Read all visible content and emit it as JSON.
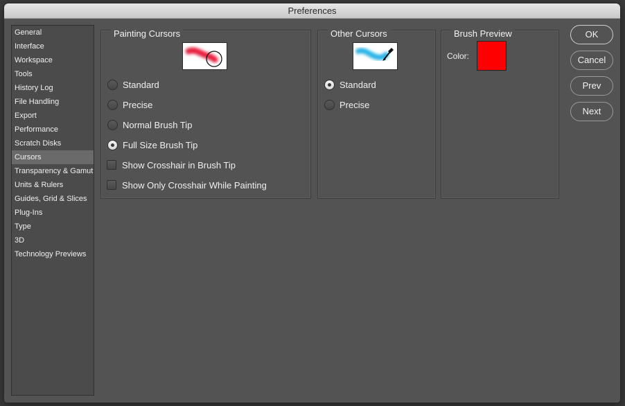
{
  "window": {
    "title": "Preferences"
  },
  "sidebar": {
    "items": [
      {
        "label": "General"
      },
      {
        "label": "Interface"
      },
      {
        "label": "Workspace"
      },
      {
        "label": "Tools"
      },
      {
        "label": "History Log"
      },
      {
        "label": "File Handling"
      },
      {
        "label": "Export"
      },
      {
        "label": "Performance"
      },
      {
        "label": "Scratch Disks"
      },
      {
        "label": "Cursors",
        "selected": true
      },
      {
        "label": "Transparency & Gamut"
      },
      {
        "label": "Units & Rulers"
      },
      {
        "label": "Guides, Grid & Slices"
      },
      {
        "label": "Plug-Ins"
      },
      {
        "label": "Type"
      },
      {
        "label": "3D"
      },
      {
        "label": "Technology Previews"
      }
    ]
  },
  "painting_cursors": {
    "title": "Painting Cursors",
    "options": [
      {
        "label": "Standard",
        "checked": false
      },
      {
        "label": "Precise",
        "checked": false
      },
      {
        "label": "Normal Brush Tip",
        "checked": false
      },
      {
        "label": "Full Size Brush Tip",
        "checked": true
      }
    ],
    "checkboxes": [
      {
        "label": "Show Crosshair in Brush Tip",
        "checked": false
      },
      {
        "label": "Show Only Crosshair While Painting",
        "checked": false
      }
    ]
  },
  "other_cursors": {
    "title": "Other Cursors",
    "options": [
      {
        "label": "Standard",
        "checked": true
      },
      {
        "label": "Precise",
        "checked": false
      }
    ]
  },
  "brush_preview": {
    "title": "Brush Preview",
    "color_label": "Color:",
    "color": "#ff0000"
  },
  "buttons": {
    "ok": "OK",
    "cancel": "Cancel",
    "prev": "Prev",
    "next": "Next"
  },
  "colors": {
    "panel": "#535353",
    "selection": "#6a6a6a",
    "brush_red": "#e8213f",
    "brush_blue": "#2ab4e6"
  }
}
